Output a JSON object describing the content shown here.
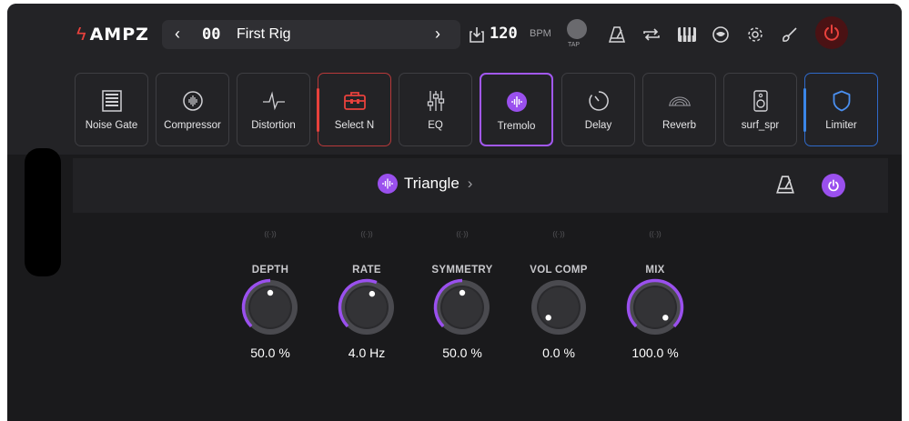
{
  "app": {
    "logo": "AMPZ"
  },
  "rig": {
    "prev": "‹",
    "number": "00",
    "name": "First Rig",
    "next": "›"
  },
  "tempo": {
    "bpm": "120",
    "bpm_label": "BPM",
    "tap_label": "TAP"
  },
  "colors": {
    "accent_purple": "#9a50ee",
    "accent_red": "#e8413c",
    "accent_blue": "#2f69c9"
  },
  "pedals": [
    {
      "label": "Noise Gate",
      "icon": "noise-gate-icon"
    },
    {
      "label": "Compressor",
      "icon": "compressor-icon"
    },
    {
      "label": "Distortion",
      "icon": "distortion-icon"
    },
    {
      "label": "Select N",
      "icon": "toolbox-icon"
    },
    {
      "label": "EQ",
      "icon": "eq-sliders-icon"
    },
    {
      "label": "Tremolo",
      "icon": "tremolo-icon"
    },
    {
      "label": "Delay",
      "icon": "delay-icon"
    },
    {
      "label": "Reverb",
      "icon": "reverb-icon"
    },
    {
      "label": "surf_spr",
      "icon": "speaker-icon"
    },
    {
      "label": "Limiter",
      "icon": "shield-icon"
    }
  ],
  "preset": {
    "name": "Triangle",
    "chevron": "›"
  },
  "knobs": [
    {
      "label": "DEPTH",
      "value": "50.0 %",
      "level": 0.5
    },
    {
      "label": "RATE",
      "value": "4.0 Hz",
      "level": 0.58
    },
    {
      "label": "SYMMETRY",
      "value": "50.0 %",
      "level": 0.5
    },
    {
      "label": "VOL COMP",
      "value": "0.0 %",
      "level": 0.0
    },
    {
      "label": "MIX",
      "value": "100.0 %",
      "level": 1.0
    }
  ]
}
